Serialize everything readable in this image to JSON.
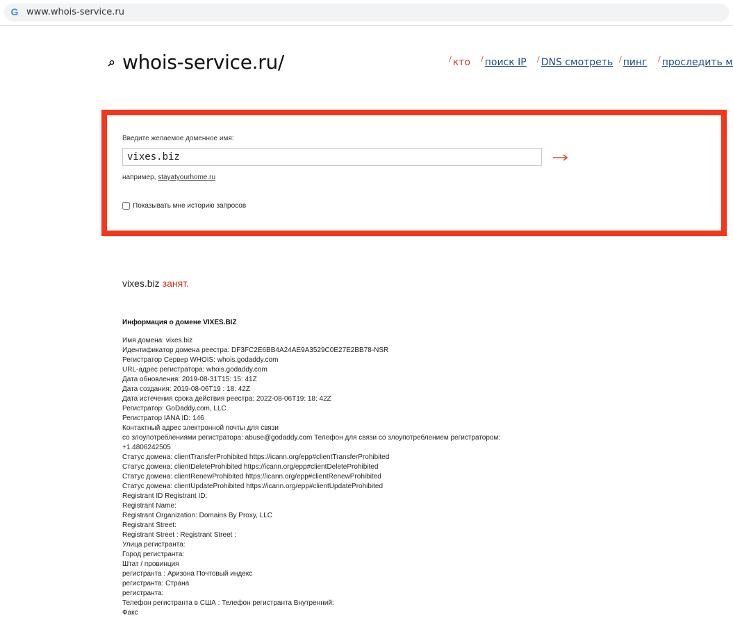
{
  "browser": {
    "url": "www.whois-service.ru",
    "favicon": "google-g-icon"
  },
  "header": {
    "logo": "whois-service.ru/",
    "nav": [
      {
        "label": "кто",
        "active": true
      },
      {
        "label": "поиск IP",
        "active": false
      },
      {
        "label": "DNS смотреть",
        "active": false
      },
      {
        "label": "пинг",
        "active": false
      },
      {
        "label": "проследить ма",
        "active": false
      }
    ]
  },
  "search": {
    "prompt": "Введите желаемое доменное имя:",
    "value": "vixes.biz",
    "example_prefix": "например, ",
    "example_link": "stayatyourhome.ru",
    "history_label": "Показывать мне историю запросов",
    "history_checked": false,
    "submit_icon": "arrow-right-icon"
  },
  "result": {
    "domain": "vixes.biz",
    "status": "занят."
  },
  "info": {
    "title": "Информация о домене VIXES.BIZ",
    "lines": [
      "Имя домена: vixes.biz",
      "Идентификатор домена реестра: DF3FC2E6BB4A24AE9A3529C0E27E2BB78-NSR",
      "Регистратор Сервер WHOIS: whois.godaddy.com",
      "URL-адрес регистратора: whois.godaddy.com",
      "Дата обновления: 2019-08-31T15: 15: 41Z",
      "Дата создания: 2019-08-06T19 : 18: 42Z",
      "Дата истечения срока действия реестра: 2022-08-06T19: 18: 42Z",
      "Регистратор: GoDaddy.com, LLC",
      "Регистратор IANA ID: 146",
      "Контактный адрес электронной почты для связи",
      "со злоупотреблениями регистратора: abuse@godaddy.com Телефон для связи со злоупотреблением регистратором:",
      "+1.4806242505",
      "Статус домена: clientTransferProhibited https://icann.org/epp#clientTransferProhibited",
      "Статус домена: clientDeleteProhibited https://icann.org/epp#clientDeleteProhibited",
      "Статус домена: clientRenewProhibited https://icann.org/epp#clientRenewProhibited",
      "Статус домена: clientUpdateProhibited https://icann.org/epp#clientUpdateProhibited",
      "Registrant ID Registrant ID:",
      "Registrant Name:",
      "Registrant Organization: Domains By Proxy, LLC",
      "Registrant Street:",
      "Registrant Street : Registrant Street :",
      "Улица регистранта:",
      "Город регистранта:",
      "Штат / провинция",
      "регистранта : Аризона Почтовый индекс",
      "регистранта: Страна",
      "регистранта:",
      "Телефон регистранта в США : Телефон регистранта Внутренний:",
      "Факс"
    ]
  },
  "colors": {
    "accent": "#f3361c",
    "link": "#1a4b8c",
    "status_taken": "#d0391f"
  }
}
